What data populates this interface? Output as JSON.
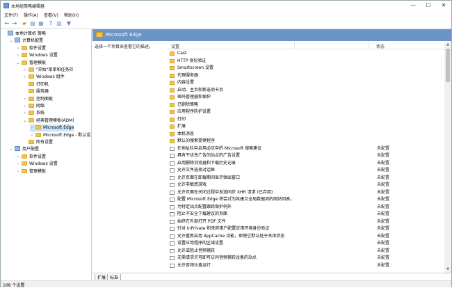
{
  "window": {
    "title": "本地组策略编辑器"
  },
  "menu": [
    "文件(F)",
    "操作(A)",
    "查看(V)",
    "帮助(H)"
  ],
  "tree": [
    {
      "label": "本地计算机 策略",
      "indent": 0,
      "expander": "",
      "icon": "computer"
    },
    {
      "label": "计算机配置",
      "indent": 1,
      "expander": "⌄",
      "icon": "computer"
    },
    {
      "label": "软件设置",
      "indent": 2,
      "expander": "›",
      "icon": "folder"
    },
    {
      "label": "Windows 设置",
      "indent": 2,
      "expander": "›",
      "icon": "folder"
    },
    {
      "label": "管理模板",
      "indent": 2,
      "expander": "⌄",
      "icon": "folder"
    },
    {
      "label": "\"开始\"菜单和任务栏",
      "indent": 3,
      "expander": "›",
      "icon": "folder"
    },
    {
      "label": "Windows 组件",
      "indent": 3,
      "expander": "›",
      "icon": "folder"
    },
    {
      "label": "打印机",
      "indent": 3,
      "expander": "",
      "icon": "folder"
    },
    {
      "label": "服务器",
      "indent": 3,
      "expander": "",
      "icon": "folder"
    },
    {
      "label": "控制面板",
      "indent": 3,
      "expander": "›",
      "icon": "folder"
    },
    {
      "label": "网络",
      "indent": 3,
      "expander": "›",
      "icon": "folder"
    },
    {
      "label": "系统",
      "indent": 3,
      "expander": "›",
      "icon": "folder"
    },
    {
      "label": "经典管理模板(ADM)",
      "indent": 3,
      "expander": "⌄",
      "icon": "folder"
    },
    {
      "label": "Microsoft Edge",
      "indent": 4,
      "expander": "›",
      "icon": "folder",
      "selected": true
    },
    {
      "label": "Microsoft Edge - 默认设置",
      "indent": 4,
      "expander": "›",
      "icon": "folder"
    },
    {
      "label": "所有设置",
      "indent": 3,
      "expander": "",
      "icon": "folder"
    },
    {
      "label": "用户配置",
      "indent": 1,
      "expander": "⌄",
      "icon": "computer"
    },
    {
      "label": "软件设置",
      "indent": 2,
      "expander": "›",
      "icon": "folder"
    },
    {
      "label": "Windows 设置",
      "indent": 2,
      "expander": "›",
      "icon": "folder"
    },
    {
      "label": "管理模板",
      "indent": 2,
      "expander": "›",
      "icon": "folder"
    }
  ],
  "panel": {
    "header": "Microsoft Edge",
    "description": "选择一个项目来查看它的描述。",
    "col_setting": "设置",
    "col_state": "状态"
  },
  "rows": [
    {
      "name": "Cast",
      "type": "folder",
      "state": ""
    },
    {
      "name": "HTTP 身份验证",
      "type": "folder",
      "state": ""
    },
    {
      "name": "Smartscreen 设置",
      "type": "folder",
      "state": ""
    },
    {
      "name": "代理服务器",
      "type": "folder",
      "state": ""
    },
    {
      "name": "内容设置",
      "type": "folder",
      "state": ""
    },
    {
      "name": "启动、主页和新选项卡页",
      "type": "folder",
      "state": ""
    },
    {
      "name": "密码管理器和保护",
      "type": "folder",
      "state": ""
    },
    {
      "name": "已删除策略",
      "type": "folder",
      "state": ""
    },
    {
      "name": "应用程序防护设置",
      "type": "folder",
      "state": ""
    },
    {
      "name": "打印",
      "type": "folder",
      "state": ""
    },
    {
      "name": "扩展",
      "type": "folder",
      "state": ""
    },
    {
      "name": "本机消息",
      "type": "folder",
      "state": ""
    },
    {
      "name": "默认的搜索提供程序",
      "type": "folder",
      "state": ""
    },
    {
      "name": "在地址栏中启用必应中的 Microsoft 搜索建议",
      "type": "policy",
      "state": "未配置"
    },
    {
      "name": "具有干扰性广告的站点的广告设置",
      "type": "policy",
      "state": "未配置"
    },
    {
      "name": "启用删除浏览器和下载历史记录",
      "type": "policy",
      "state": "未配置"
    },
    {
      "name": "允许文件选择对话框",
      "type": "policy",
      "state": "未配置"
    },
    {
      "name": "允许页面在卸载期间显示弹出窗口",
      "type": "policy",
      "state": "未配置"
    },
    {
      "name": "允许非敏感游戏",
      "type": "policy",
      "state": "未配置"
    },
    {
      "name": "允许页面在关闭过程中发送同步 XHR 请求 (已弃用)",
      "type": "policy",
      "state": "未配置"
    },
    {
      "name": "配置 Microsoft Edge 将尝试为其建立全局数据项的网站列表。",
      "type": "policy",
      "state": "未配置"
    },
    {
      "name": "为特定站点配置跟踪保护例外",
      "type": "policy",
      "state": "未配置"
    },
    {
      "name": "阻止不安全下载建议的页面",
      "type": "policy",
      "state": "未配置"
    },
    {
      "name": "始终在外部打开 PDF 文件",
      "type": "policy",
      "state": "未配置"
    },
    {
      "name": "针对 InPrivate 和来宾用户配置应用环境身份验证",
      "type": "policy",
      "state": "未配置"
    },
    {
      "name": "允许重新启用 AppCache 功能，即使它默认处于关闭状态",
      "type": "policy",
      "state": "未配置"
    },
    {
      "name": "设置应用程序的区域设置",
      "type": "policy",
      "state": "未配置"
    },
    {
      "name": "允许或阻止音频捕获",
      "type": "policy",
      "state": "未配置"
    },
    {
      "name": "无需请求许可即可访问音频捕获设备的站点",
      "type": "policy",
      "state": "未配置"
    },
    {
      "name": "允许音频沙盒运行",
      "type": "policy",
      "state": "未配置"
    }
  ],
  "tabs": [
    "扩展",
    "标准"
  ],
  "status": "168 个设置"
}
